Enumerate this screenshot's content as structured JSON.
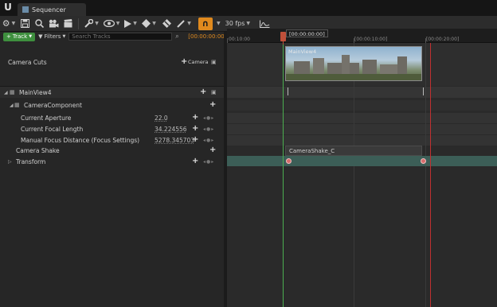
{
  "window": {
    "tab_title": "Sequencer"
  },
  "toolbar": {
    "fps_label": "30 fps",
    "icons": [
      "settings-icon",
      "save-icon",
      "search-icon",
      "camera-icon",
      "clapper-icon",
      "tools-icon",
      "visibility-icon",
      "play-icon",
      "key-icon",
      "filter-icon",
      "brush-icon",
      "snap-icon",
      "curve-icon"
    ]
  },
  "filter_row": {
    "track_label": "Track",
    "filters_label": "Filters",
    "search_placeholder": "Search Tracks",
    "timecode": "[00:00:00:00]"
  },
  "tracks": {
    "camera_cuts": {
      "label": "Camera Cuts",
      "camera_button": "Camera"
    },
    "main_view": {
      "label": "MainView4"
    },
    "camera_component": {
      "label": "CameraComponent"
    },
    "properties": [
      {
        "label": "Current Aperture",
        "value": "22.0"
      },
      {
        "label": "Current Focal Length",
        "value": "34.224556"
      },
      {
        "label": "Manual Focus Distance (Focus Settings)",
        "value": "5278.345703"
      }
    ],
    "camera_shake": {
      "label": "Camera Shake"
    },
    "transform": {
      "label": "Transform"
    }
  },
  "timeline": {
    "playhead_label": "[00:00:00:00]",
    "ruler_labels": [
      "00:10:00",
      "[00:00:10:00]",
      "[00:00:20:00]"
    ],
    "camera_cut_clip": "MainView4",
    "shake_clip": "CameraShake_C"
  },
  "colors": {
    "accent_orange": "#e08a1e",
    "track_green": "#3e8f3e",
    "playhead_green": "#4caf50",
    "end_red": "#c03030",
    "transform_lane": "#3c5e57"
  }
}
